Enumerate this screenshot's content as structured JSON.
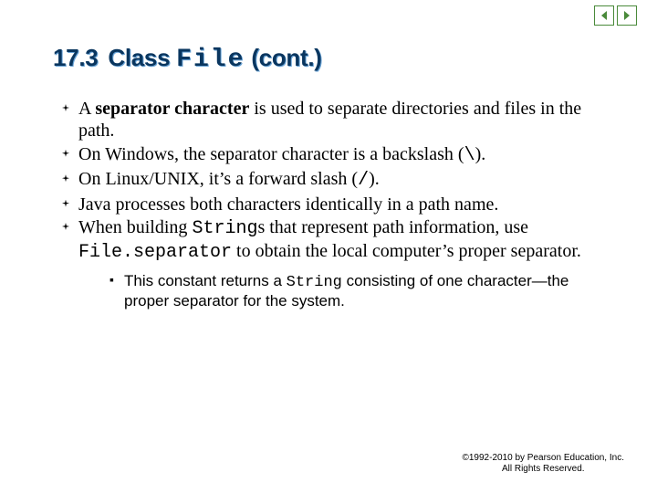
{
  "heading": {
    "number": "17.3",
    "word_class": "Class",
    "word_file": "File",
    "word_cont": "(cont.)"
  },
  "bullets": {
    "b1_pre": "A ",
    "b1_bold": "separator character",
    "b1_post": " is used to separate directories and files in the path.",
    "b2_pre": "On Windows, the separator character is a backslash (",
    "b2_code": "\\",
    "b2_post": ").",
    "b3_pre": "On Linux/UNIX, it’s a forward slash (",
    "b3_code": "/",
    "b3_post": ").",
    "b4": "Java processes both characters identically in a path name.",
    "b5_pre": "When building ",
    "b5_code1": "String",
    "b5_mid": "s that represent path information, use ",
    "b5_code2": "File.separator",
    "b5_post": " to obtain the local computer’s proper separator.",
    "s1_pre": "This constant returns a ",
    "s1_code": "String",
    "s1_post": " consisting of one character—the proper separator for the system."
  },
  "footer": {
    "line1": "©1992-2010 by Pearson Education, Inc.",
    "line2": "All Rights Reserved."
  }
}
